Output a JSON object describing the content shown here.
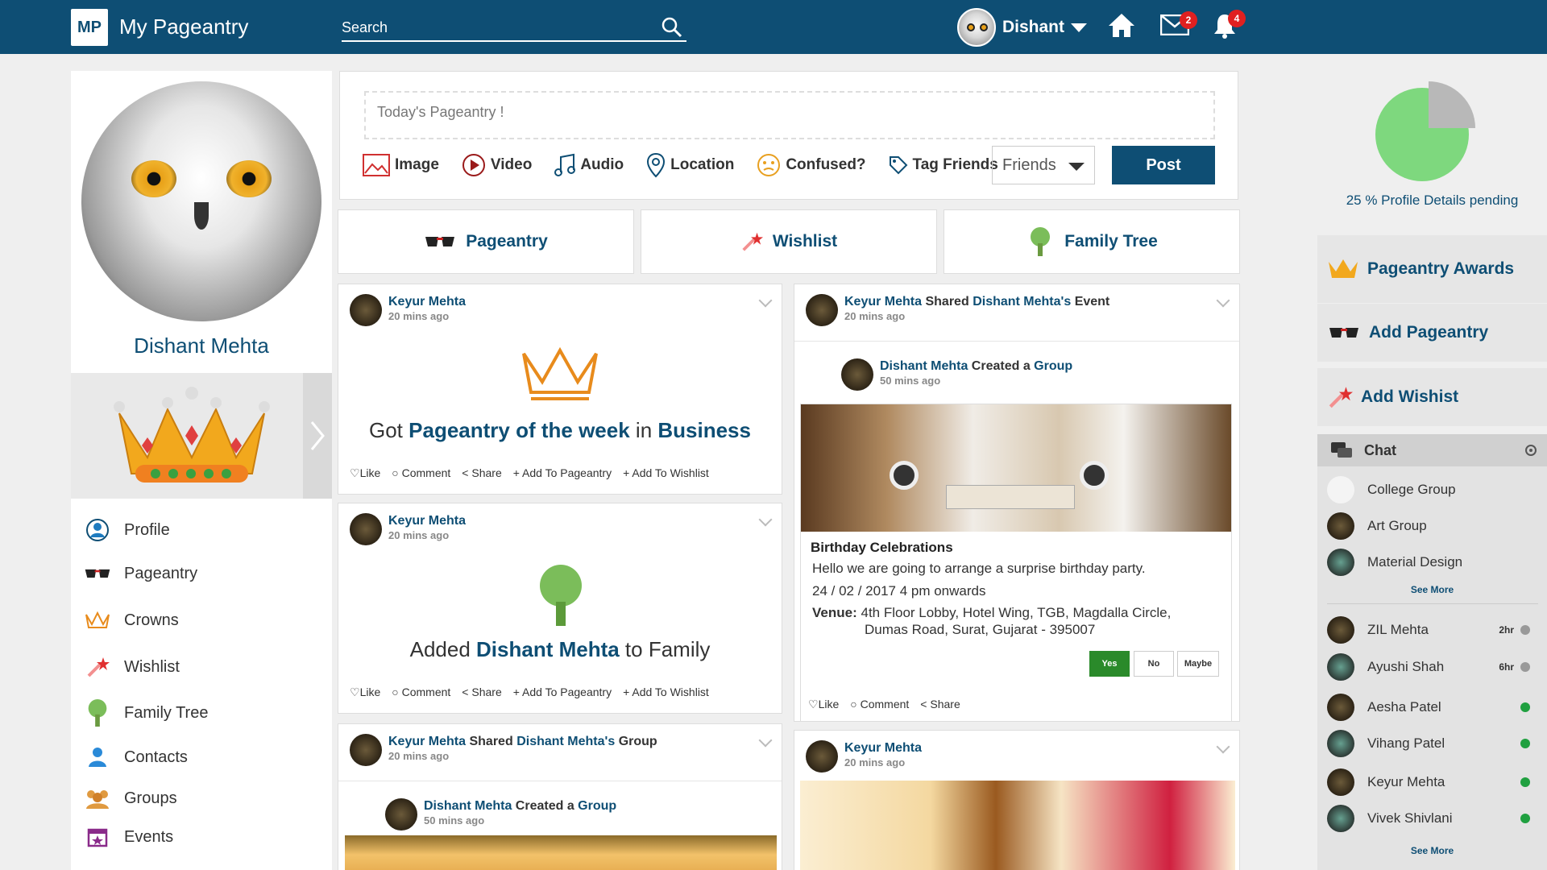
{
  "topbar": {
    "logo": "MP",
    "app_name": "My Pageantry",
    "search_placeholder": "Search",
    "user": "Dishant",
    "mail_count": "2",
    "notif_count": "4"
  },
  "profile": {
    "name": "Dishant Mehta"
  },
  "menu": [
    "Profile",
    "Pageantry",
    "Crowns",
    "Wishlist",
    "Family Tree",
    "Contacts",
    "Groups",
    "Events"
  ],
  "composer": {
    "placeholder": "Today's Pageantry !",
    "tools": [
      "Image",
      "Video",
      "Audio",
      "Location",
      "Confused?",
      "Tag Friends"
    ],
    "privacy": "Friends",
    "post_label": "Post"
  },
  "tabs": [
    "Pageantry",
    "Wishlist",
    "Family Tree"
  ],
  "posts": [
    {
      "author": "Keyur Mehta",
      "time": "20 mins ago",
      "text_pre": "Got ",
      "text_b1": "Pageantry of the week",
      "text_mid": " in ",
      "text_b2": "Business",
      "actions": [
        "Like",
        "Comment",
        "Share",
        "Add To Pageantry",
        "Add To Wishlist"
      ]
    },
    {
      "author": "Keyur Mehta",
      "time": "20 mins ago",
      "text_pre": "Added ",
      "text_b1": "Dishant Mehta",
      "text_post": " to Family",
      "actions": [
        "Like",
        "Comment",
        "Share",
        "Add To Pageantry",
        "Add To Wishlist"
      ]
    },
    {
      "author": "Keyur Mehta",
      "shared": "Shared",
      "target": "Dishant Mehta's",
      "kind": "Group",
      "time": "20 mins ago",
      "inner_author": "Dishant Mehta",
      "inner_action": "Created a",
      "inner_kind": "Group",
      "inner_time": "50 mins ago"
    },
    {
      "author": "Keyur Mehta",
      "shared": "Shared",
      "target": "Dishant Mehta's",
      "kind": "Event",
      "time": "20 mins ago",
      "inner_author": "Dishant Mehta",
      "inner_action": "Created a",
      "inner_kind": "Group",
      "inner_time": "50 mins ago",
      "event_title": "Birthday Celebrations",
      "event_desc": "Hello we are going to arrange a surprise birthday party.",
      "event_date": "24 / 02 / 2017  4 pm onwards",
      "venue_label": "Venue:",
      "venue_1": "4th Floor Lobby, Hotel Wing, TGB, Magdalla Circle,",
      "venue_2": "Dumas Road, Surat, Gujarat - 395007",
      "rsvp": [
        "Yes",
        "No",
        "Maybe"
      ],
      "actions": [
        "Like",
        "Comment",
        "Share"
      ]
    },
    {
      "author": "Keyur Mehta",
      "time": "20 mins ago"
    }
  ],
  "sidebar": {
    "pending_pct": 25,
    "pending_text": "25 % Profile Details pending",
    "awards": "Pageantry Awards",
    "add_pageantry": "Add Pageantry",
    "add_wishlist": "Add Wishist",
    "chat_title": "Chat",
    "groups": [
      "College Group",
      "Art Group",
      "Material Design"
    ],
    "see_more": "See More",
    "contacts": [
      {
        "name": "ZIL Mehta",
        "time": "2hr",
        "status": "away"
      },
      {
        "name": "Ayushi Shah",
        "time": "6hr",
        "status": "away"
      },
      {
        "name": "Aesha Patel",
        "time": "",
        "status": "online"
      },
      {
        "name": "Vihang Patel",
        "time": "",
        "status": "online"
      },
      {
        "name": "Keyur Mehta",
        "time": "",
        "status": "online"
      },
      {
        "name": "Vivek Shivlani",
        "time": "",
        "status": "online"
      }
    ]
  },
  "colors": {
    "brand": "#0e4e74",
    "online": "#20a040",
    "away": "#999999",
    "yes": "#2a8a2a"
  }
}
